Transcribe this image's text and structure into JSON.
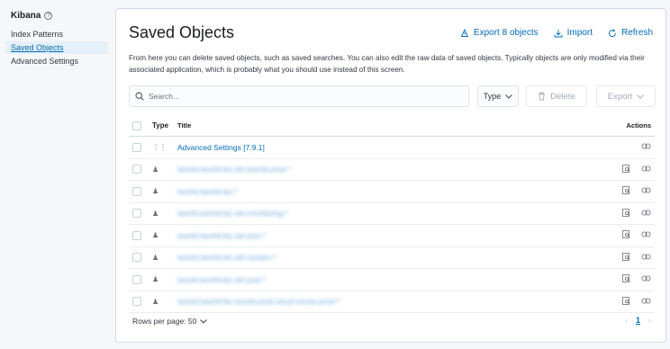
{
  "sidebar": {
    "title": "Kibana",
    "items": [
      {
        "label": "Index Patterns",
        "active": false
      },
      {
        "label": "Saved Objects",
        "active": true
      },
      {
        "label": "Advanced Settings",
        "active": false
      }
    ]
  },
  "page": {
    "title": "Saved Objects",
    "export_all_label": "Export 8 objects",
    "import_label": "Import",
    "refresh_label": "Refresh",
    "description": "From here you can delete saved objects, such as saved searches. You can also edit the raw data of saved objects. Typically objects are only modified via their associated application, which is probably what you should use instead of this screen."
  },
  "toolbar": {
    "search_placeholder": "Search...",
    "type_label": "Type",
    "delete_label": "Delete",
    "export_label": "Export"
  },
  "table": {
    "columns": {
      "type": "Type",
      "title": "Title",
      "actions": "Actions"
    },
    "rows": [
      {
        "type_icon": "config-icon",
        "title": "Advanced Settings [7.9.1]",
        "blurred": false,
        "inspect": false
      },
      {
        "type_icon": "index-pattern-icon",
        "title": "tworld.tworld-biz.skt-tworld-prod.*",
        "blurred": true,
        "inspect": true
      },
      {
        "type_icon": "index-pattern-icon",
        "title": "tworld.tworld-biz.*",
        "blurred": true,
        "inspect": true
      },
      {
        "type_icon": "index-pattern-icon",
        "title": "tworld.tworld-biz.skt-monitoring-*",
        "blurred": true,
        "inspect": true
      },
      {
        "type_icon": "index-pattern-icon",
        "title": "tworld.tworld-biz.skt-pod-*",
        "blurred": true,
        "inspect": true
      },
      {
        "type_icon": "index-pattern-icon",
        "title": "tworld.tworld-biz.skt-system-*",
        "blurred": true,
        "inspect": true
      },
      {
        "type_icon": "index-pattern-icon",
        "title": "tworld.tworld-biz.skt-pod-*",
        "blurred": true,
        "inspect": true
      },
      {
        "type_icon": "index-pattern-icon",
        "title": "tworld.tworld-biz.tworld-prod.cloud-movie-prod-*",
        "blurred": true,
        "inspect": true
      }
    ]
  },
  "footer": {
    "rows_per_page_label": "Rows per page: 50",
    "current_page": "1"
  },
  "colors": {
    "accent": "#006bb8",
    "text": "#343741",
    "border": "#d3dae6"
  }
}
